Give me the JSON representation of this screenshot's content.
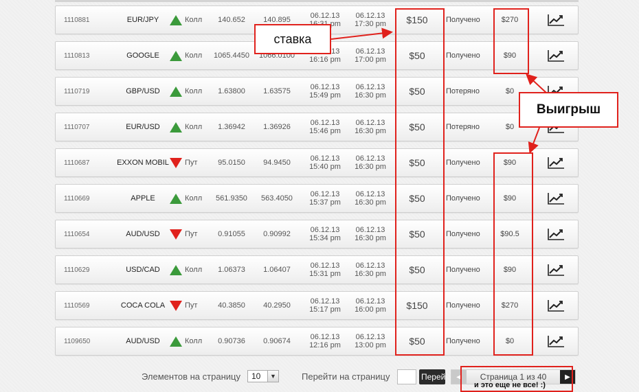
{
  "rows": [
    {
      "id": "1110881",
      "asset": "EUR/JPY",
      "dir": "up",
      "dir_label": "Колл",
      "open": "140.652",
      "close": "140.895",
      "d1": "06.12.13",
      "t1": "16:31 pm",
      "d2": "06.12.13",
      "t2": "17:30 pm",
      "amount": "$150",
      "status": "Получено",
      "payout": "$270"
    },
    {
      "id": "1110813",
      "asset": "GOOGLE",
      "dir": "up",
      "dir_label": "Колл",
      "open": "1065.4450",
      "close": "1066.0100",
      "d1": "06.12.13",
      "t1": "16:16 pm",
      "d2": "06.12.13",
      "t2": "17:00 pm",
      "amount": "$50",
      "status": "Получено",
      "payout": "$90"
    },
    {
      "id": "1110719",
      "asset": "GBP/USD",
      "dir": "up",
      "dir_label": "Колл",
      "open": "1.63800",
      "close": "1.63575",
      "d1": "06.12.13",
      "t1": "15:49 pm",
      "d2": "06.12.13",
      "t2": "16:30 pm",
      "amount": "$50",
      "status": "Потеряно",
      "payout": "$0"
    },
    {
      "id": "1110707",
      "asset": "EUR/USD",
      "dir": "up",
      "dir_label": "Колл",
      "open": "1.36942",
      "close": "1.36926",
      "d1": "06.12.13",
      "t1": "15:46 pm",
      "d2": "06.12.13",
      "t2": "16:30 pm",
      "amount": "$50",
      "status": "Потеряно",
      "payout": "$0"
    },
    {
      "id": "1110687",
      "asset": "EXXON MOBIL",
      "dir": "down",
      "dir_label": "Пут",
      "open": "95.0150",
      "close": "94.9450",
      "d1": "06.12.13",
      "t1": "15:40 pm",
      "d2": "06.12.13",
      "t2": "16:30 pm",
      "amount": "$50",
      "status": "Получено",
      "payout": "$90"
    },
    {
      "id": "1110669",
      "asset": "APPLE",
      "dir": "up",
      "dir_label": "Колл",
      "open": "561.9350",
      "close": "563.4050",
      "d1": "06.12.13",
      "t1": "15:37 pm",
      "d2": "06.12.13",
      "t2": "16:30 pm",
      "amount": "$50",
      "status": "Получено",
      "payout": "$90"
    },
    {
      "id": "1110654",
      "asset": "AUD/USD",
      "dir": "down",
      "dir_label": "Пут",
      "open": "0.91055",
      "close": "0.90992",
      "d1": "06.12.13",
      "t1": "15:34 pm",
      "d2": "06.12.13",
      "t2": "16:30 pm",
      "amount": "$50",
      "status": "Получено",
      "payout": "$90.5"
    },
    {
      "id": "1110629",
      "asset": "USD/CAD",
      "dir": "up",
      "dir_label": "Колл",
      "open": "1.06373",
      "close": "1.06407",
      "d1": "06.12.13",
      "t1": "15:31 pm",
      "d2": "06.12.13",
      "t2": "16:30 pm",
      "amount": "$50",
      "status": "Получено",
      "payout": "$90"
    },
    {
      "id": "1110569",
      "asset": "COCA COLA",
      "dir": "down",
      "dir_label": "Пут",
      "open": "40.3850",
      "close": "40.2950",
      "d1": "06.12.13",
      "t1": "15:17 pm",
      "d2": "06.12.13",
      "t2": "16:00 pm",
      "amount": "$150",
      "status": "Получено",
      "payout": "$270"
    },
    {
      "id": "1109650",
      "asset": "AUD/USD",
      "dir": "up",
      "dir_label": "Колл",
      "open": "0.90736",
      "close": "0.90674",
      "d1": "06.12.13",
      "t1": "12:16 pm",
      "d2": "06.12.13",
      "t2": "13:00 pm",
      "amount": "$50",
      "status": "Получено",
      "payout": "$0"
    }
  ],
  "annotations": {
    "stake": "ставка",
    "win": "Выигрыш",
    "extra": "и это еще не все! :)"
  },
  "footer": {
    "per_page_label": "Элементов на страницу",
    "per_page_value": "10",
    "goto_label": "Перейти на страницу",
    "goto_button": "Перей",
    "page_info": "Страница 1 из 40"
  },
  "colors": {
    "up": "#3b9a3b",
    "down": "#e0211c",
    "annotation": "#e0211c"
  },
  "icons": {
    "chart": "trend-chart-icon",
    "prev": "chevron-left-icon",
    "next": "chevron-right-icon",
    "dropdown": "chevron-down-icon"
  }
}
